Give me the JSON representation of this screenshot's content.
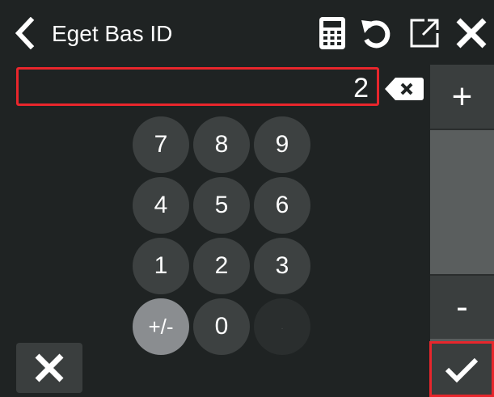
{
  "header": {
    "title": "Eget Bas ID",
    "back_icon": "chevron-left-icon",
    "calculator_icon": "calculator-icon",
    "reset_icon": "undo-icon",
    "popout_icon": "external-link-icon",
    "close_icon": "close-icon"
  },
  "input": {
    "value": "2",
    "backspace_icon": "backspace-icon"
  },
  "keypad": {
    "k7": "7",
    "k8": "8",
    "k9": "9",
    "k4": "4",
    "k5": "5",
    "k6": "6",
    "k1": "1",
    "k2": "2",
    "k3": "3",
    "sign": "+/-",
    "k0": "0",
    "blank": "."
  },
  "side": {
    "plus": "+",
    "minus": "-",
    "confirm_icon": "checkmark-icon"
  },
  "footer": {
    "cancel_icon": "close-icon"
  },
  "colors": {
    "background": "#1f2323",
    "key": "#3d4141",
    "sign_key": "#8a8d90",
    "panel": "#5a5e5e",
    "accent_red": "#e8262c"
  }
}
